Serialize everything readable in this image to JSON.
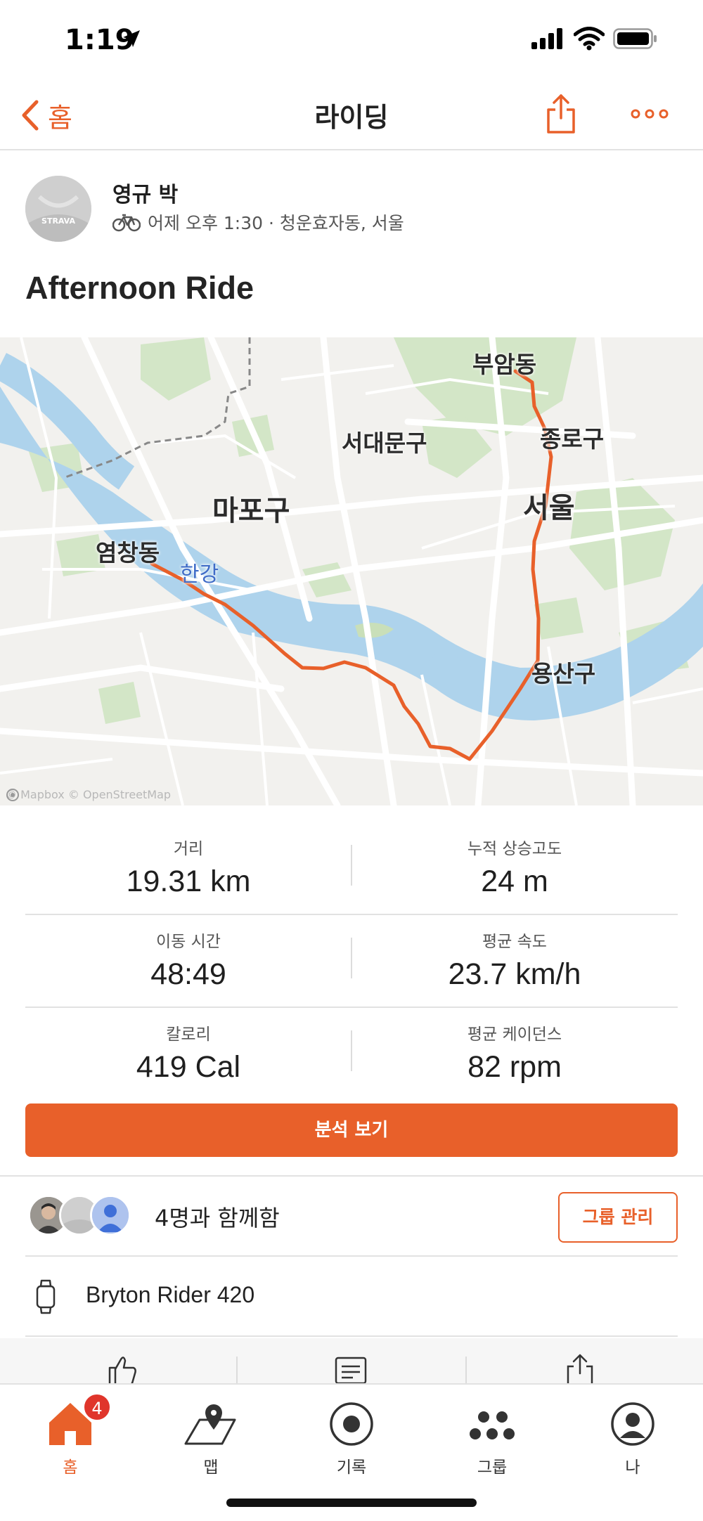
{
  "status": {
    "time": "1:19"
  },
  "nav": {
    "back_label": "홈",
    "title": "라이딩"
  },
  "athlete": {
    "name": "영규 박",
    "meta": "어제 오후 1:30 · 청운효자동, 서울",
    "avatar_text": "STRAVA"
  },
  "activity": {
    "title": "Afternoon Ride"
  },
  "map": {
    "labels": {
      "buam": "부암동",
      "seodaemun": "서대문구",
      "jongno": "종로구",
      "mapo": "마포구",
      "seoul": "서울",
      "yeomchang": "염창동",
      "hangang": "한강",
      "yongsan": "용산구"
    },
    "attribution": "© Mapbox © OpenStreetMap",
    "route_color": "#e8602a",
    "water_color": "#aed3ec",
    "park_color": "#cfe3c4"
  },
  "stats": [
    {
      "left_label": "거리",
      "left_value": "19.31 km",
      "right_label": "누적 상승고도",
      "right_value": "24 m"
    },
    {
      "left_label": "이동 시간",
      "left_value": "48:49",
      "right_label": "평균 속도",
      "right_value": "23.7 km/h"
    },
    {
      "left_label": "칼로리",
      "left_value": "419 Cal",
      "right_label": "평균 케이던스",
      "right_value": "82 rpm"
    }
  ],
  "analysis_button": "분석 보기",
  "group": {
    "text": "4명과 함께함",
    "button": "그룹 관리"
  },
  "device": {
    "name": "Bryton Rider 420"
  },
  "tabs": [
    {
      "label": "홈",
      "icon": "home-icon",
      "badge": "4"
    },
    {
      "label": "맵",
      "icon": "map-icon"
    },
    {
      "label": "기록",
      "icon": "record-icon"
    },
    {
      "label": "그룹",
      "icon": "groups-icon"
    },
    {
      "label": "나",
      "icon": "profile-icon"
    }
  ],
  "accent_color": "#e8602a"
}
